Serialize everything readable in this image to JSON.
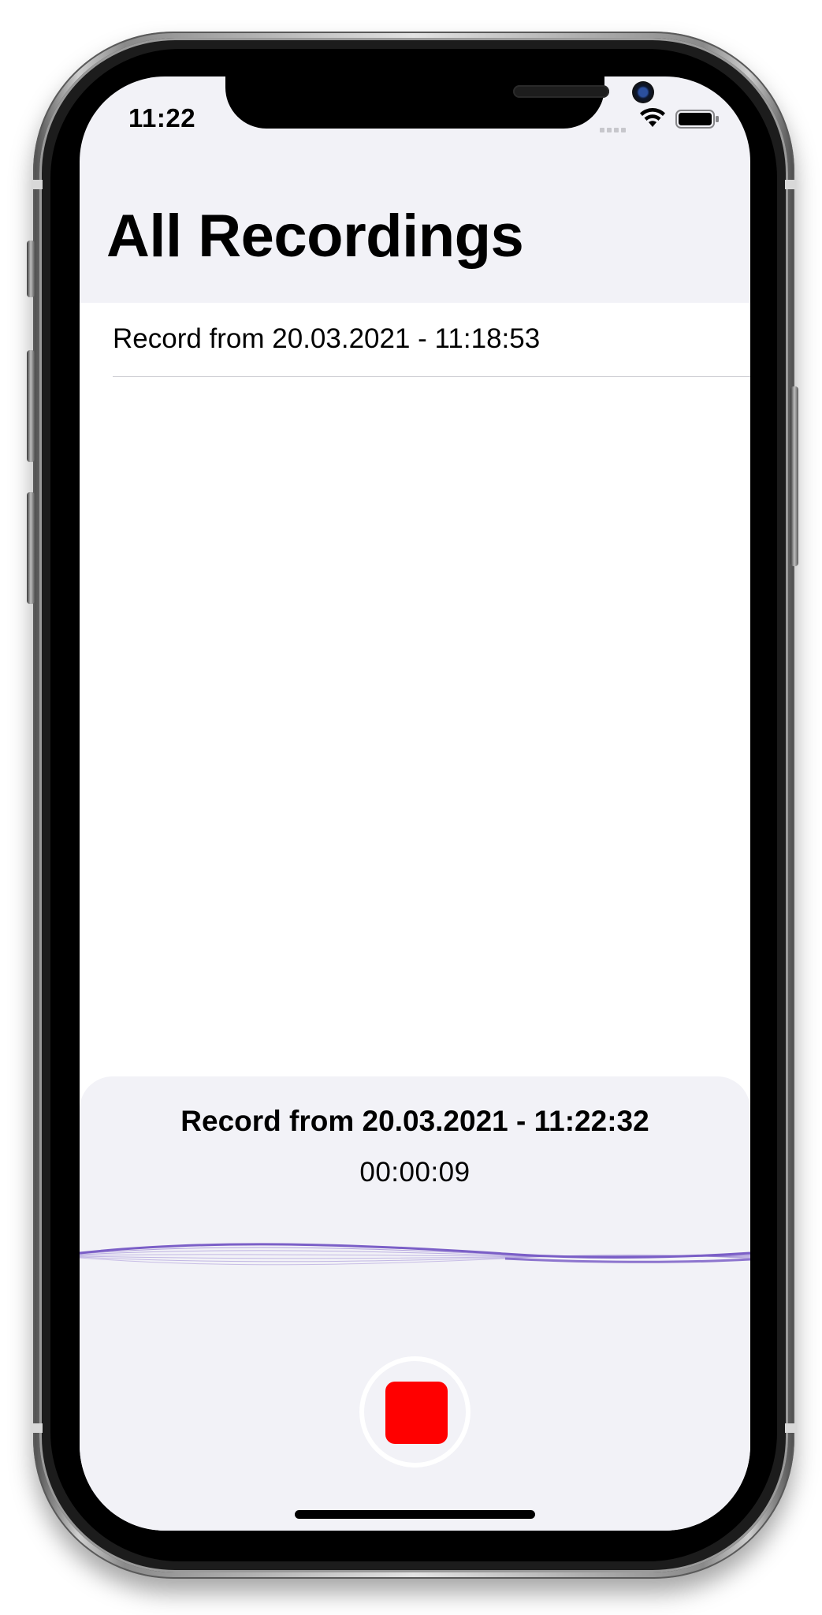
{
  "status_bar": {
    "time": "11:22",
    "wifi_icon": "wifi-icon",
    "battery_icon": "battery-icon"
  },
  "header": {
    "title": "All Recordings"
  },
  "recordings": [
    {
      "label": "Record from 20.03.2021 - 11:18:53"
    }
  ],
  "recorder": {
    "current_title": "Record from 20.03.2021 - 11:22:32",
    "elapsed": "00:00:09",
    "stop_icon": "stop-icon"
  },
  "colors": {
    "stop": "#ff0000",
    "waveform": "#7b5fc7",
    "panel_background": "#f2f2f7"
  }
}
